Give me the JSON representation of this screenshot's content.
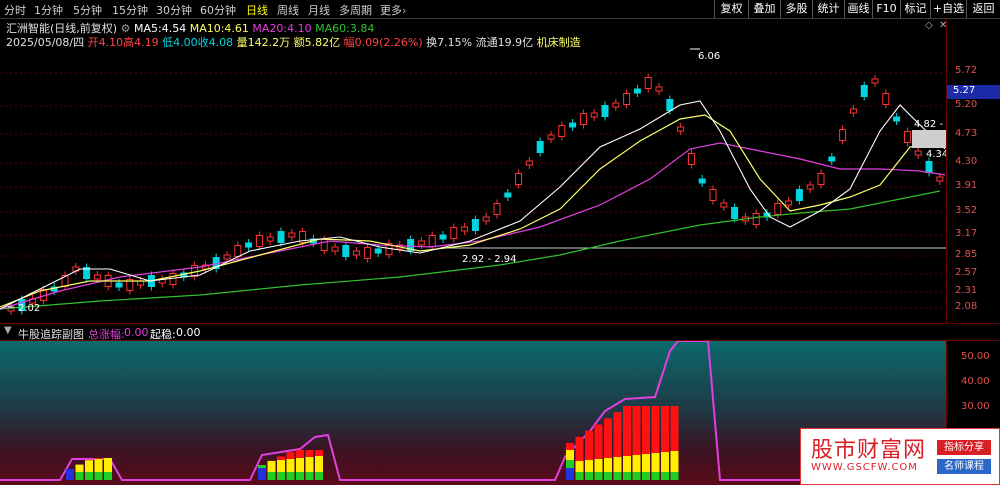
{
  "periods": [
    "分时",
    "1分钟",
    "5分钟",
    "15分钟",
    "30分钟",
    "60分钟",
    "日线",
    "周线",
    "月线",
    "多周期",
    "更多"
  ],
  "active_period": "日线",
  "right_buttons": [
    "复权",
    "叠加",
    "多股",
    "统计",
    "画线",
    "F10",
    "标记",
    "+自选",
    "返回"
  ],
  "title": "汇洲智能(日线,前复权)",
  "ma": {
    "ma5_label": "MA5:",
    "ma5": "4.54",
    "ma10_label": "MA10:",
    "ma10": "4.61",
    "ma20_label": "MA20:",
    "ma20": "4.10",
    "ma60_label": "MA60:",
    "ma60": "3.84"
  },
  "day": {
    "date": "2025/05/08/四",
    "open_label": "开",
    "open": "4.10",
    "high_label": "高",
    "high": "4.19",
    "low_label": "低",
    "low": "4.00",
    "close_label": "收",
    "close": "4.08",
    "vol_label": "量",
    "vol": "142.2万",
    "amt_label": "额",
    "amt": "5.82亿",
    "chg_label": "幅",
    "chg": "0.09(2.26%)",
    "turn_label": "换",
    "turn": "7.15%",
    "float_label": "流通",
    "float": "19.9亿",
    "sector": "机床制造"
  },
  "price_axis": [
    "5.72",
    "5.20",
    "4.73",
    "4.30",
    "3.91",
    "3.52",
    "3.17",
    "2.85",
    "2.57",
    "2.31",
    "2.08"
  ],
  "current_price": "5.27",
  "annotations": {
    "high": "6.06",
    "low": "2.02",
    "mid": "2.92 - 2.94",
    "box": "4.82 - 4",
    "last": "4.34"
  },
  "sub": {
    "name": "牛股追踪副图",
    "k1_label": "总涨幅:",
    "k1": "0.00",
    "k2_label": "起稳:",
    "k2": "0.00",
    "axis": [
      "50.00",
      "40.00",
      "30.00"
    ]
  },
  "watermark": {
    "title": "股市财富网",
    "url": "WWW.GSCFW.COM",
    "tag1": "指标分享",
    "tag2": "名师课程"
  },
  "colors": {
    "up": "#ff3333",
    "down": "#00d5e0",
    "ma5": "#ffffff",
    "ma10": "#ffff66",
    "ma20": "#e040e0",
    "ma60": "#30c030"
  }
}
